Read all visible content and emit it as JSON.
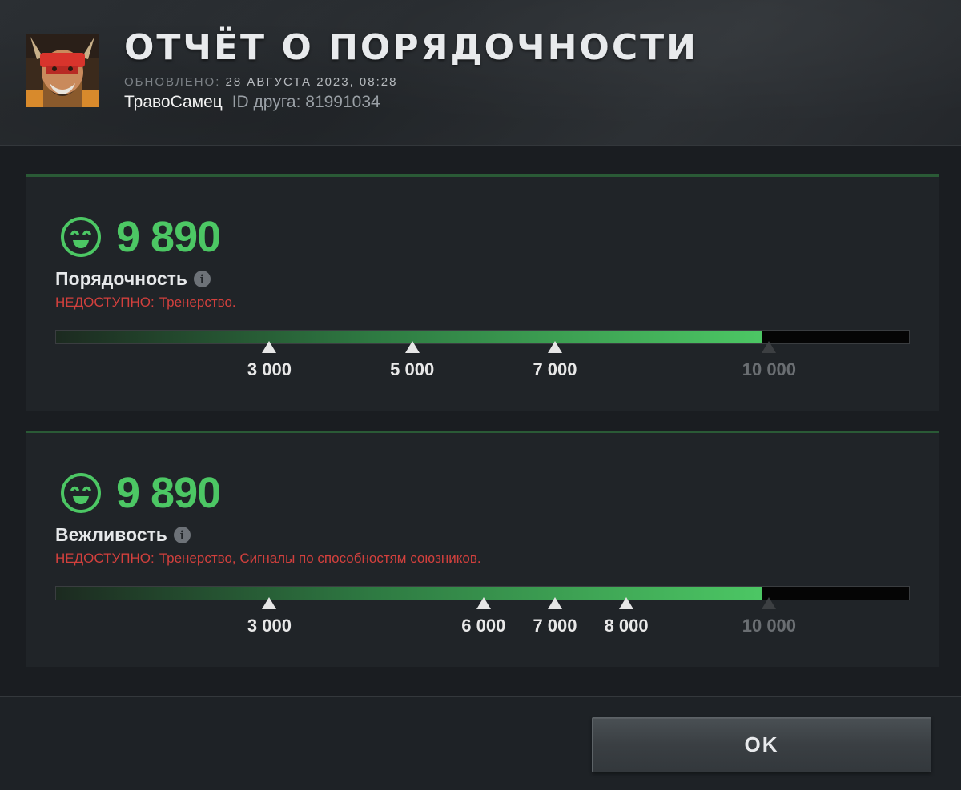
{
  "header": {
    "title": "ОТЧЁТ О ПОРЯДОЧНОСТИ",
    "updated_label": "ОБНОВЛЕНО:",
    "updated_value": "28 АВГУСТА 2023, 08:28",
    "username": "ТравоСамец",
    "friend_id_text": "ID друга: 81991034",
    "avatar": "hero-avatar"
  },
  "panels": [
    {
      "score": "9 890",
      "score_value": 9890,
      "label": "Порядочность",
      "unavailable_label": "НЕДОСТУПНО:",
      "unavailable_text": "Тренерство.",
      "scale_max": 10000,
      "markers": [
        {
          "value": 3000,
          "label": "3 000",
          "reached": true
        },
        {
          "value": 5000,
          "label": "5 000",
          "reached": true
        },
        {
          "value": 7000,
          "label": "7 000",
          "reached": true
        },
        {
          "value": 10000,
          "label": "10 000",
          "reached": false
        }
      ]
    },
    {
      "score": "9 890",
      "score_value": 9890,
      "label": "Вежливость",
      "unavailable_label": "НЕДОСТУПНО:",
      "unavailable_text": "Тренерство, Сигналы по способностям союзников.",
      "scale_max": 10000,
      "markers": [
        {
          "value": 3000,
          "label": "3 000",
          "reached": true
        },
        {
          "value": 6000,
          "label": "6 000",
          "reached": true
        },
        {
          "value": 7000,
          "label": "7 000",
          "reached": true
        },
        {
          "value": 8000,
          "label": "8 000",
          "reached": true
        },
        {
          "value": 10000,
          "label": "10 000",
          "reached": false
        }
      ]
    }
  ],
  "footer": {
    "ok_label": "OK"
  },
  "colors": {
    "score_green": "#4cc764",
    "unavailable_red": "#d2403d",
    "panel_bg": "#202428"
  }
}
